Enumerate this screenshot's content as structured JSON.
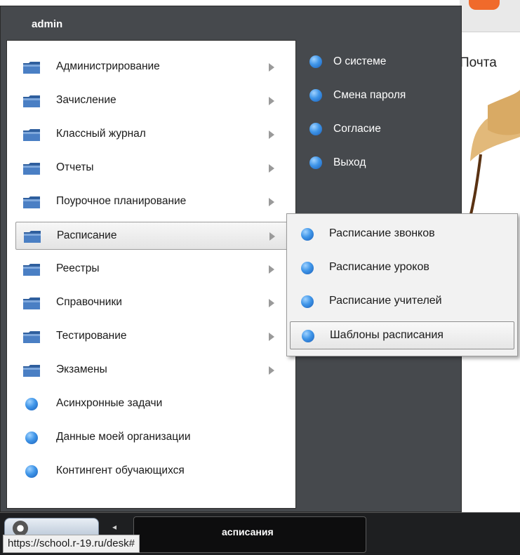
{
  "window": {
    "title": "admin"
  },
  "background": {
    "mail_label": "Почта"
  },
  "left_menu": {
    "items": [
      {
        "label": "Администрирование",
        "icon": "folder-icon",
        "has_submenu": true
      },
      {
        "label": "Зачисление",
        "icon": "folder-icon",
        "has_submenu": true
      },
      {
        "label": "Классный журнал",
        "icon": "folder-icon",
        "has_submenu": true
      },
      {
        "label": "Отчеты",
        "icon": "folder-icon",
        "has_submenu": true
      },
      {
        "label": "Поурочное планирование",
        "icon": "folder-icon",
        "has_submenu": true
      },
      {
        "label": "Расписание",
        "icon": "folder-icon",
        "has_submenu": true,
        "active": true
      },
      {
        "label": "Реестры",
        "icon": "folder-icon",
        "has_submenu": true
      },
      {
        "label": "Справочники",
        "icon": "folder-icon",
        "has_submenu": true
      },
      {
        "label": "Тестирование",
        "icon": "folder-icon",
        "has_submenu": true
      },
      {
        "label": "Экзамены",
        "icon": "folder-icon",
        "has_submenu": true
      },
      {
        "label": "Асинхронные задачи",
        "icon": "blue-dot-icon"
      },
      {
        "label": "Данные моей организации",
        "icon": "blue-dot-icon"
      },
      {
        "label": "Контингент обучающихся",
        "icon": "blue-dot-icon"
      }
    ]
  },
  "right_menu": {
    "items": [
      {
        "label": "О системе",
        "icon": "blue-dot-icon"
      },
      {
        "label": "Смена пароля",
        "icon": "blue-dot-icon"
      },
      {
        "label": "Согласие",
        "icon": "blue-dot-icon"
      },
      {
        "label": "Выход",
        "icon": "blue-dot-icon"
      }
    ]
  },
  "submenu": {
    "parent": "Расписание",
    "items": [
      {
        "label": "Расписание звонков",
        "icon": "blue-dot-icon"
      },
      {
        "label": "Расписание уроков",
        "icon": "blue-dot-icon"
      },
      {
        "label": "Расписание учителей",
        "icon": "blue-dot-icon"
      },
      {
        "label": "Шаблоны расписания",
        "icon": "blue-dot-icon",
        "hovered": true
      }
    ]
  },
  "taskbar": {
    "task_label": "асписания",
    "status_url": "https://school.r-19.ru/desk#"
  },
  "colors": {
    "menu_bg": "#46494d",
    "icon_blue": "#3f95e8",
    "folder_blue": "#2f5f9e",
    "taskbar_bg": "#1e1f21"
  }
}
